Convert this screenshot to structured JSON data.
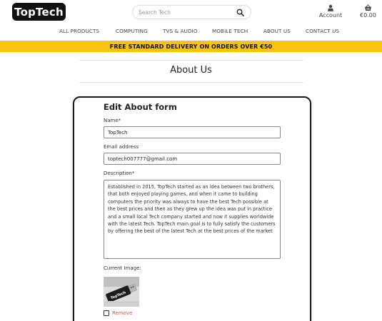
{
  "header": {
    "logo_text": "TopTech",
    "search_placeholder": "Search Tech",
    "account_label": "Account",
    "cart_total": "€0.00",
    "icons": {
      "search": "search-icon",
      "account": "user-icon",
      "cart": "basket-icon"
    }
  },
  "nav": {
    "items": [
      {
        "label": "ALL PRODUCTS"
      },
      {
        "label": "COMPUTING"
      },
      {
        "label": "TVS & AUDIO"
      },
      {
        "label": "MOBILE TECH"
      },
      {
        "label": "ABOUT US"
      },
      {
        "label": "CONTACT US"
      }
    ]
  },
  "banner": {
    "text": "FREE STANDARD DELIVERY ON ORDERS OVER €50",
    "color": "#f9c311"
  },
  "page": {
    "title": "About Us"
  },
  "form": {
    "title": "Edit About form",
    "name": {
      "label": "Name*",
      "value": "TopTech"
    },
    "email": {
      "label": "Email address",
      "value": "toptech007777@gmail.com"
    },
    "description": {
      "label": "Description*",
      "value": "Established in 2015, TopTech started as an idea between two brothers, that both enjoyed playing games, and when it came to building computers the priority was always to have the best Tech possible at the best prices and then as they grew up the idea was put in practice and a small local Tech company started and now it supplies worldwide with the latest Tech. TopTech main goal is to fully satisfy the customers by offering the best of the latest Tech at the best prices of the market"
    },
    "current_image": {
      "label": "Current Image:",
      "image_text": "TopTech"
    },
    "remove": {
      "label": "Remove",
      "color": "#d9534f"
    }
  }
}
